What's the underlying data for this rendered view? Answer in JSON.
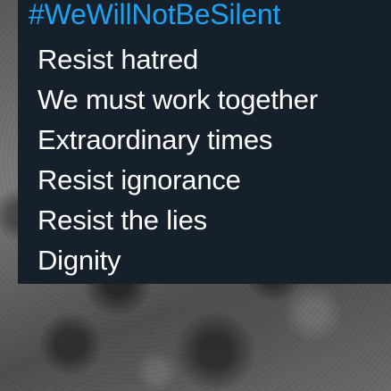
{
  "tweet": {
    "hashtag": "#WeWillNotBeSilent",
    "lines": [
      "Resist hatred",
      "We must work together",
      "Extraordinary times",
      "Resist ignorance",
      "Resist the lies",
      "Dignity"
    ]
  },
  "colors": {
    "card_background": "#16202a",
    "hashtag": "#1da1f2",
    "text": "#ffffff"
  }
}
